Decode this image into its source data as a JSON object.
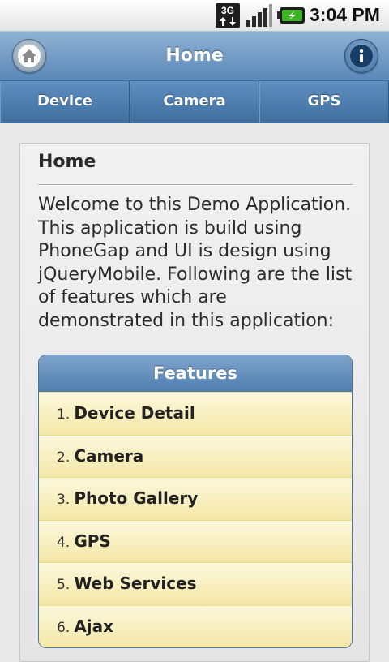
{
  "status_bar": {
    "network_label": "3G",
    "time": "3:04 PM",
    "icons": [
      "3g-data-icon",
      "signal-strength-icon",
      "battery-charging-icon"
    ]
  },
  "header": {
    "title": "Home",
    "left_button": "home-icon",
    "right_button": "info-icon"
  },
  "navbar": {
    "tabs": [
      {
        "label": "Device"
      },
      {
        "label": "Camera"
      },
      {
        "label": "GPS"
      }
    ]
  },
  "content": {
    "title": "Home",
    "intro": "Welcome to this Demo Application. This application is build using PhoneGap and UI is design using jQueryMobile. Following are the list of features which are demonstrated in this application:",
    "features": {
      "header": "Features",
      "items": [
        {
          "num": "1.",
          "label": "Device Detail"
        },
        {
          "num": "2.",
          "label": "Camera"
        },
        {
          "num": "3.",
          "label": "Photo Gallery"
        },
        {
          "num": "4.",
          "label": "GPS"
        },
        {
          "num": "5.",
          "label": "Web Services"
        },
        {
          "num": "6.",
          "label": "Ajax"
        }
      ]
    }
  },
  "colors": {
    "header_top": "#8fb2d4",
    "header_bottom": "#5a88b8",
    "tab_top": "#5f8fc0",
    "tab_bottom": "#3e6f9f",
    "list_item": "#f4e7a6",
    "battery_green": "#2e8b1e"
  }
}
